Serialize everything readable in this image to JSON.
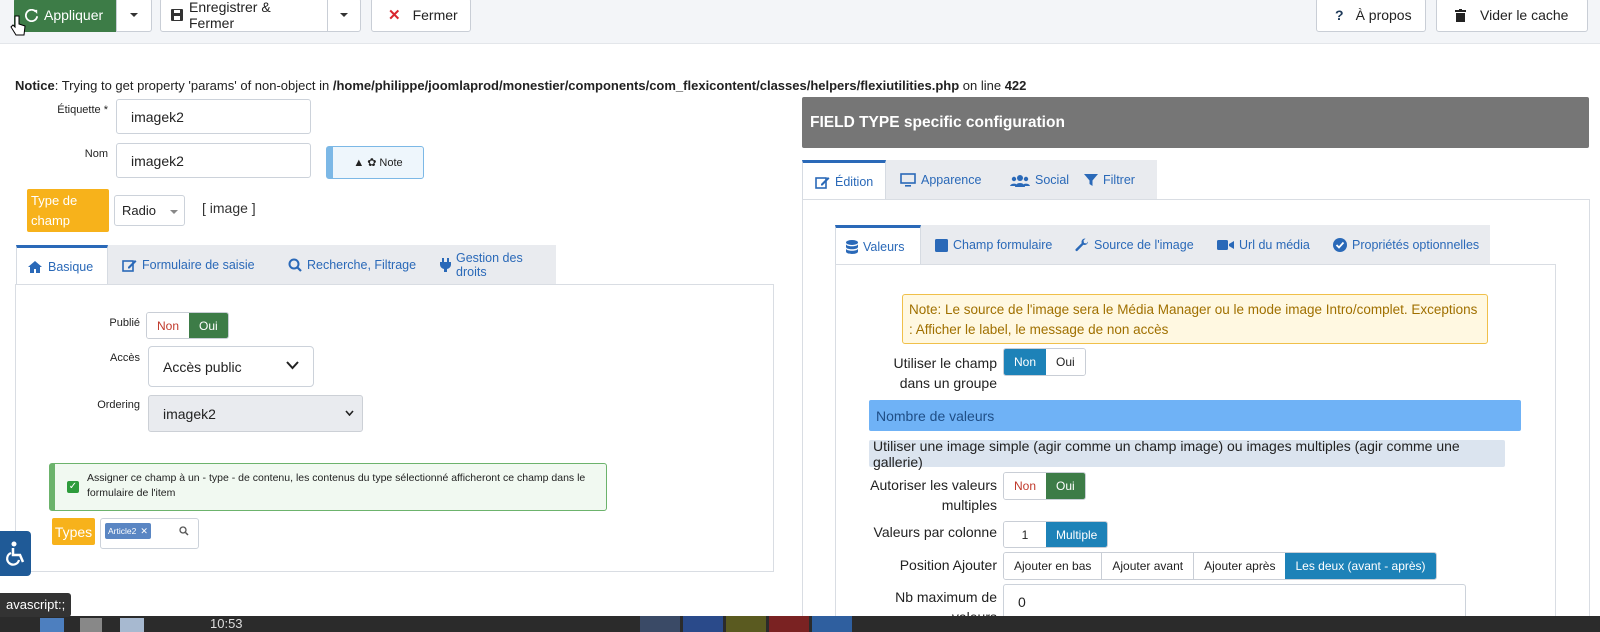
{
  "toolbar": {
    "apply": "Appliquer",
    "save_close": "Enregistrer & Fermer",
    "close": "Fermer",
    "about": "À propos",
    "clear_cache": "Vider le cache"
  },
  "notice": {
    "prefix": "Notice",
    "message": ": Trying to get property 'params' of non-object in ",
    "path": "/home/philippe/joomlaprod/monestier/components/com_flexicontent/classes/helpers/flexiutilities.php",
    "on_line": " on line ",
    "line": "422"
  },
  "form": {
    "label_label": "Étiquette *",
    "label_value": "imagek2",
    "name_label": "Nom",
    "name_value": "imagek2",
    "note_button": "Note",
    "field_type_label": "Type de champ",
    "field_type_value": "Radio",
    "field_type_tag": "[ image ]"
  },
  "left_tabs": [
    "Basique",
    "Formulaire de saisie",
    "Recherche, Filtrage",
    "Gestion des droits"
  ],
  "basic": {
    "published_label": "Publié",
    "no": "Non",
    "yes": "Oui",
    "access_label": "Accès",
    "access_value": "Accès public",
    "ordering_label": "Ordering",
    "ordering_value": "imagek2",
    "assign_text": "Assigner ce champ à un - type - de contenu, les contenus du type sélectionné afficheront ce champ dans le formulaire de l'item",
    "types_label": "Types",
    "types_chip": "Article2"
  },
  "right": {
    "header": "FIELD TYPE specific configuration",
    "tabs": [
      "Édition",
      "Apparence",
      "Social",
      "Filtrer"
    ],
    "subtabs": [
      "Valeurs",
      "Champ formulaire",
      "Source de l'image",
      "Url du média",
      "Propriétés optionnelles"
    ],
    "note": "Note: Le source de l'image sera le Média Manager ou le mode image Intro/complet. Exceptions : Afficher le label, le message de non accès",
    "use_in_group_label": "Utiliser le champ dans un groupe",
    "use_in_group_no": "Non",
    "use_in_group_yes": "Oui",
    "values_count_bar": "Nombre de valeurs",
    "simple_multi_bar": "Utiliser une image simple (agir comme un champ image) ou images multiples (agir comme une gallerie)",
    "allow_multi_label": "Autoriser les valeurs multiples",
    "allow_multi_no": "Non",
    "allow_multi_yes": "Oui",
    "per_column_label": "Valeurs par colonne",
    "per_column_value": "1",
    "per_column_mode": "Multiple",
    "position_label": "Position Ajouter",
    "position_options": [
      "Ajouter en bas",
      "Ajouter avant",
      "Ajouter après",
      "Les deux (avant - après)"
    ],
    "max_label": "Nb maximum de valeurs",
    "max_value": "0"
  },
  "status": {
    "tooltip": "avascript:;",
    "clock": "10:53"
  },
  "colors": {
    "green": "#3d7c47",
    "blue_link": "#2a69b8",
    "orange": "#f7b21b",
    "selected_blue": "#1d82b8"
  }
}
